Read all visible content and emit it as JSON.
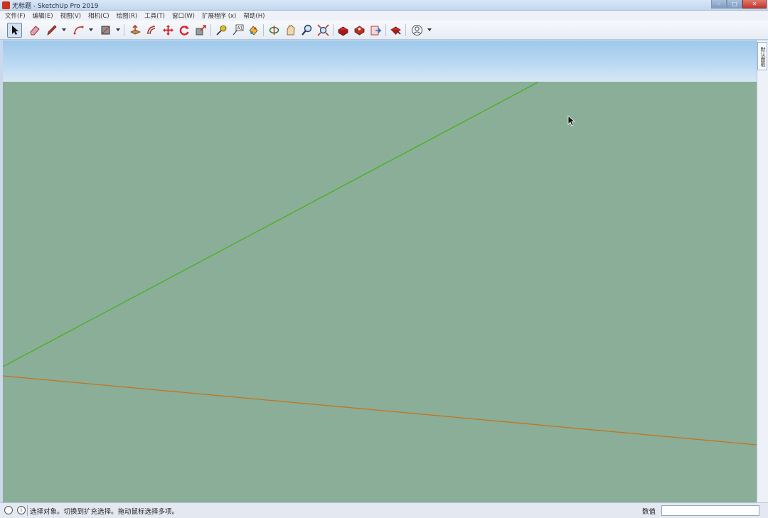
{
  "window": {
    "title": "无标题 - SketchUp Pro 2019",
    "minimize": "–",
    "maximize": "□",
    "close": "✕"
  },
  "menu": [
    {
      "label": "文件(F)"
    },
    {
      "label": "编辑(E)"
    },
    {
      "label": "视图(V)"
    },
    {
      "label": "相机(C)"
    },
    {
      "label": "绘图(R)"
    },
    {
      "label": "工具(T)"
    },
    {
      "label": "窗口(W)"
    },
    {
      "label": "扩展程序 (x)"
    },
    {
      "label": "帮助(H)"
    }
  ],
  "toolbar": {
    "tools": [
      {
        "icon": "select-arrow-icon",
        "active": true
      },
      {
        "icon": "eraser-icon"
      },
      {
        "icon": "pencil-line-icon",
        "dropdown": true
      },
      {
        "icon": "arc-icon",
        "dropdown": true
      },
      {
        "icon": "rectangle-shape-icon",
        "dropdown": true
      },
      {
        "icon": "push-pull-icon"
      },
      {
        "icon": "offset-icon"
      },
      {
        "icon": "move-icon"
      },
      {
        "icon": "rotate-icon"
      },
      {
        "icon": "scale-icon"
      },
      {
        "icon": "tape-measure-icon"
      },
      {
        "icon": "text-icon"
      },
      {
        "icon": "paint-bucket-icon"
      },
      {
        "icon": "orbit-icon"
      },
      {
        "icon": "pan-icon"
      },
      {
        "icon": "zoom-icon"
      },
      {
        "icon": "zoom-extents-icon"
      },
      {
        "icon": "3d-warehouse-icon"
      },
      {
        "icon": "extension-warehouse-icon"
      },
      {
        "icon": "send-to-layout-icon"
      },
      {
        "icon": "extension-manager-icon"
      },
      {
        "icon": "user-account-icon",
        "dropdown": true
      }
    ]
  },
  "side_panel": {
    "tab_label": "默认面板"
  },
  "statusbar": {
    "info_icon": "i",
    "message": "选择对象。切换到扩充选择。拖动鼠标选择多项。",
    "value_label": "数值",
    "value": ""
  },
  "colors": {
    "sky_top": "#9ec8ea",
    "ground": "#8aae98",
    "green_axis": "#46b21e",
    "red_axis": "#c4741c"
  }
}
